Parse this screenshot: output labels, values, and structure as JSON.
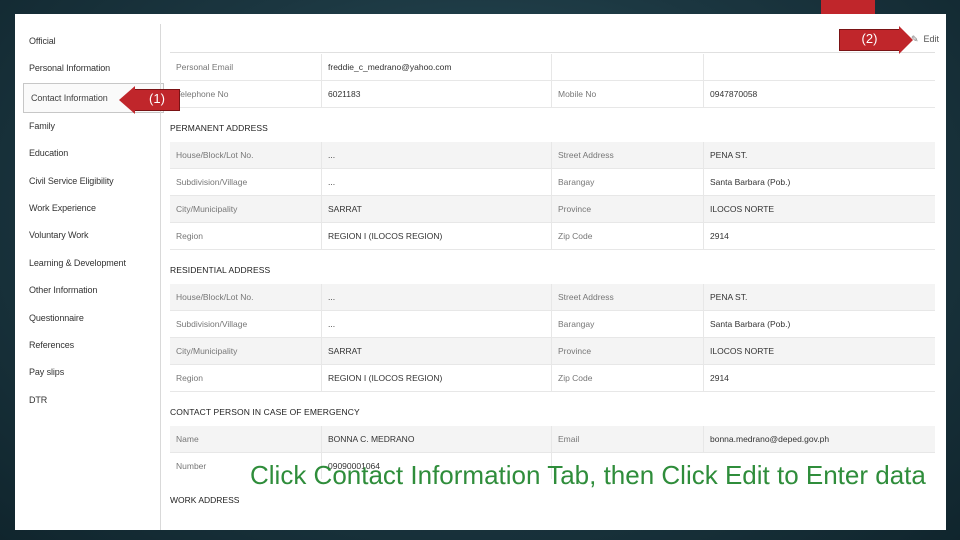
{
  "sidebar": {
    "items": [
      {
        "label": "Official"
      },
      {
        "label": "Personal Information"
      },
      {
        "label": "Contact Information",
        "active": true
      },
      {
        "label": "Family"
      },
      {
        "label": "Education"
      },
      {
        "label": "Civil Service Eligibility"
      },
      {
        "label": "Work Experience"
      },
      {
        "label": "Voluntary Work"
      },
      {
        "label": "Learning & Development"
      },
      {
        "label": "Other Information"
      },
      {
        "label": "Questionnaire"
      },
      {
        "label": "References"
      },
      {
        "label": "Pay slips"
      },
      {
        "label": "DTR"
      }
    ]
  },
  "edit": {
    "label": "Edit",
    "icon": "pencil-icon"
  },
  "contact": {
    "personal_email_label": "Personal Email",
    "personal_email": "freddie_c_medrano@yahoo.com",
    "telephone_label": "Telephone No",
    "telephone": "6021183",
    "mobile_label": "Mobile No",
    "mobile": "0947870058"
  },
  "permanent": {
    "title": "PERMANENT ADDRESS",
    "house_label": "House/Block/Lot No.",
    "house": "...",
    "street_label": "Street Address",
    "street": "PENA ST.",
    "subdivision_label": "Subdivision/Village",
    "subdivision": "...",
    "barangay_label": "Barangay",
    "barangay": "Santa Barbara (Pob.)",
    "city_label": "City/Municipality",
    "city": "SARRAT",
    "province_label": "Province",
    "province": "ILOCOS NORTE",
    "region_label": "Region",
    "region": "REGION I (ILOCOS REGION)",
    "zip_label": "Zip Code",
    "zip": "2914"
  },
  "residential": {
    "title": "RESIDENTIAL ADDRESS",
    "house_label": "House/Block/Lot No.",
    "house": "...",
    "street_label": "Street Address",
    "street": "PENA ST.",
    "subdivision_label": "Subdivision/Village",
    "subdivision": "...",
    "barangay_label": "Barangay",
    "barangay": "Santa Barbara (Pob.)",
    "city_label": "City/Municipality",
    "city": "SARRAT",
    "province_label": "Province",
    "province": "ILOCOS NORTE",
    "region_label": "Region",
    "region": "REGION I (ILOCOS REGION)",
    "zip_label": "Zip Code",
    "zip": "2914"
  },
  "emergency": {
    "title": "CONTACT PERSON IN CASE OF EMERGENCY",
    "name_label": "Name",
    "name": "BONNA C. MEDRANO",
    "email_label": "Email",
    "email": "bonna.medrano@deped.gov.ph",
    "number_label": "Number",
    "number": "09090001064"
  },
  "work_address": {
    "title": "WORK ADDRESS"
  },
  "callouts": {
    "one": "(1)",
    "two": "(2)"
  },
  "caption": "Click Contact Information Tab, then Click Edit to Enter data",
  "colors": {
    "accent": "#c0262b",
    "caption": "#2f8d3b",
    "background": "#1d3a44"
  }
}
